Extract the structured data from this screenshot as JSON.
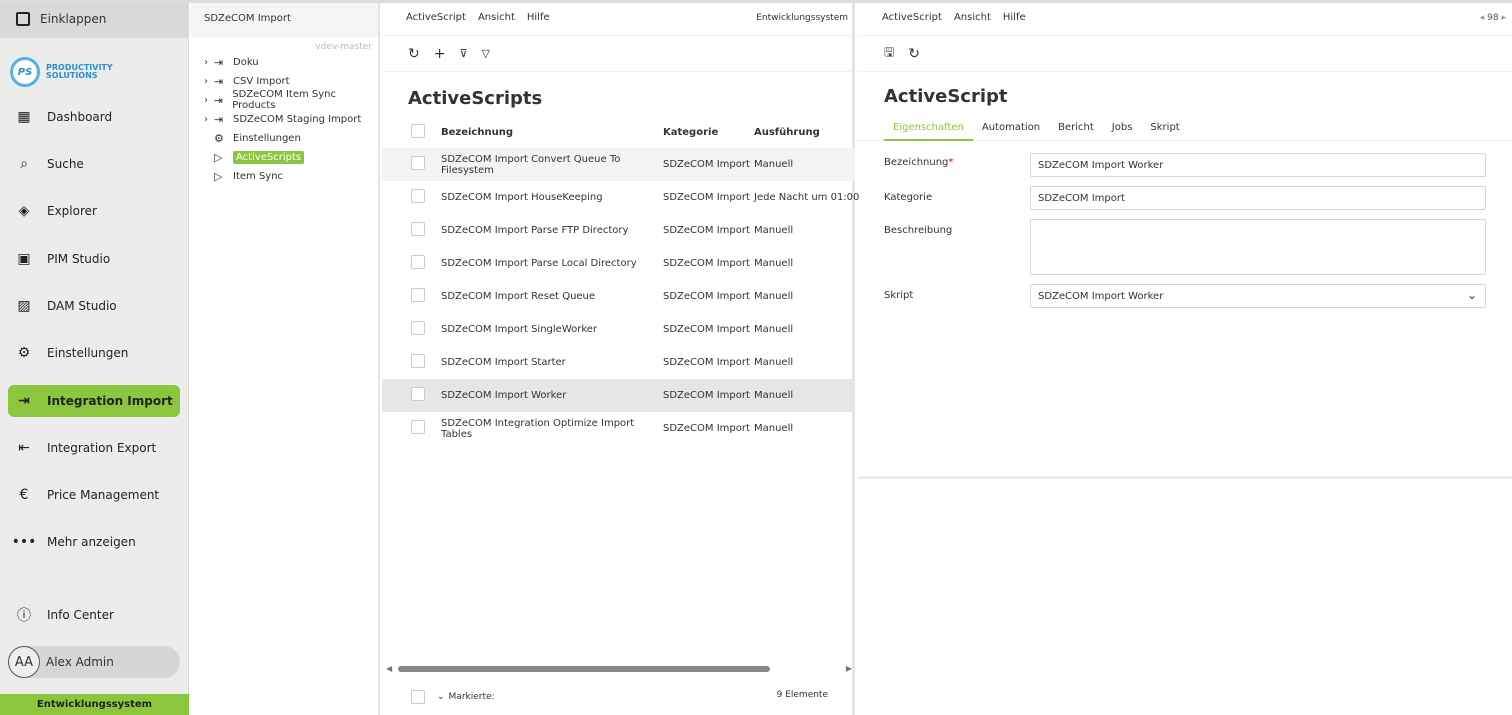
{
  "sidebar": {
    "collapse": "Einklappen",
    "logo": {
      "mark": "PS",
      "line1": "PRODUCTIVITY",
      "line2": "SOLUTIONS"
    },
    "items": [
      {
        "label": "Dashboard",
        "icon": "dashboard-icon"
      },
      {
        "label": "Suche",
        "icon": "search-icon"
      },
      {
        "label": "Explorer",
        "icon": "explorer-icon"
      },
      {
        "label": "PIM Studio",
        "icon": "pim-icon"
      },
      {
        "label": "DAM Studio",
        "icon": "image-icon"
      },
      {
        "label": "Einstellungen",
        "icon": "gear-icon"
      },
      {
        "label": "Integration Import",
        "icon": "db-import-icon",
        "active": true
      },
      {
        "label": "Integration Export",
        "icon": "db-export-icon"
      },
      {
        "label": "Price Management",
        "icon": "euro-icon"
      },
      {
        "label": "Mehr anzeigen",
        "icon": "more-icon"
      }
    ],
    "info": "Info Center",
    "user": {
      "initials": "AA",
      "name": "Alex Admin"
    },
    "env": "Entwicklungssystem"
  },
  "tree": {
    "title": "SDZeCOM Import",
    "version": "vdev-master",
    "nodes": [
      {
        "label": "Doku"
      },
      {
        "label": "CSV Import"
      },
      {
        "label": "SDZeCOM Item Sync Products"
      },
      {
        "label": "SDZeCOM Staging Import"
      },
      {
        "label": "Einstellungen"
      },
      {
        "label": "ActiveScripts"
      },
      {
        "label": "Item Sync"
      }
    ]
  },
  "list": {
    "menu": [
      "ActiveScript",
      "Ansicht",
      "Hilfe"
    ],
    "env": "Entwicklungssystem",
    "title": "ActiveScripts",
    "columns": [
      "Bezeichnung",
      "Kategorie",
      "Ausführung"
    ],
    "rows": [
      [
        "SDZeCOM Import Convert Queue To Filesystem",
        "SDZeCOM Import",
        "Manuell"
      ],
      [
        "SDZeCOM Import HouseKeeping",
        "SDZeCOM Import",
        "Jede Nacht um 01:00"
      ],
      [
        "SDZeCOM Import Parse FTP Directory",
        "SDZeCOM Import",
        "Manuell"
      ],
      [
        "SDZeCOM Import Parse Local Directory",
        "SDZeCOM Import",
        "Manuell"
      ],
      [
        "SDZeCOM Import Reset Queue",
        "SDZeCOM Import",
        "Manuell"
      ],
      [
        "SDZeCOM Import SingleWorker",
        "SDZeCOM Import",
        "Manuell"
      ],
      [
        "SDZeCOM Import Starter",
        "SDZeCOM Import",
        "Manuell"
      ],
      [
        "SDZeCOM Import Worker",
        "SDZeCOM Import",
        "Manuell"
      ],
      [
        "SDZeCOM Integration Optimize Import Tables",
        "SDZeCOM Import",
        "Manuell"
      ]
    ],
    "footer": {
      "marked": "Markierte:",
      "count": "9 Elemente"
    }
  },
  "detail": {
    "menu": [
      "ActiveScript",
      "Ansicht",
      "Hilfe"
    ],
    "page": "98",
    "title": "ActiveScript",
    "tabs": [
      "Eigenschaften",
      "Automation",
      "Bericht",
      "Jobs",
      "Skript"
    ],
    "fields": {
      "name_label": "Bezeichnung",
      "required": "*",
      "name": "SDZeCOM Import Worker",
      "cat_label": "Kategorie",
      "cat": "SDZeCOM Import",
      "desc_label": "Beschreibung",
      "desc": "",
      "script_label": "Skript",
      "script": "SDZeCOM Import Worker"
    }
  }
}
